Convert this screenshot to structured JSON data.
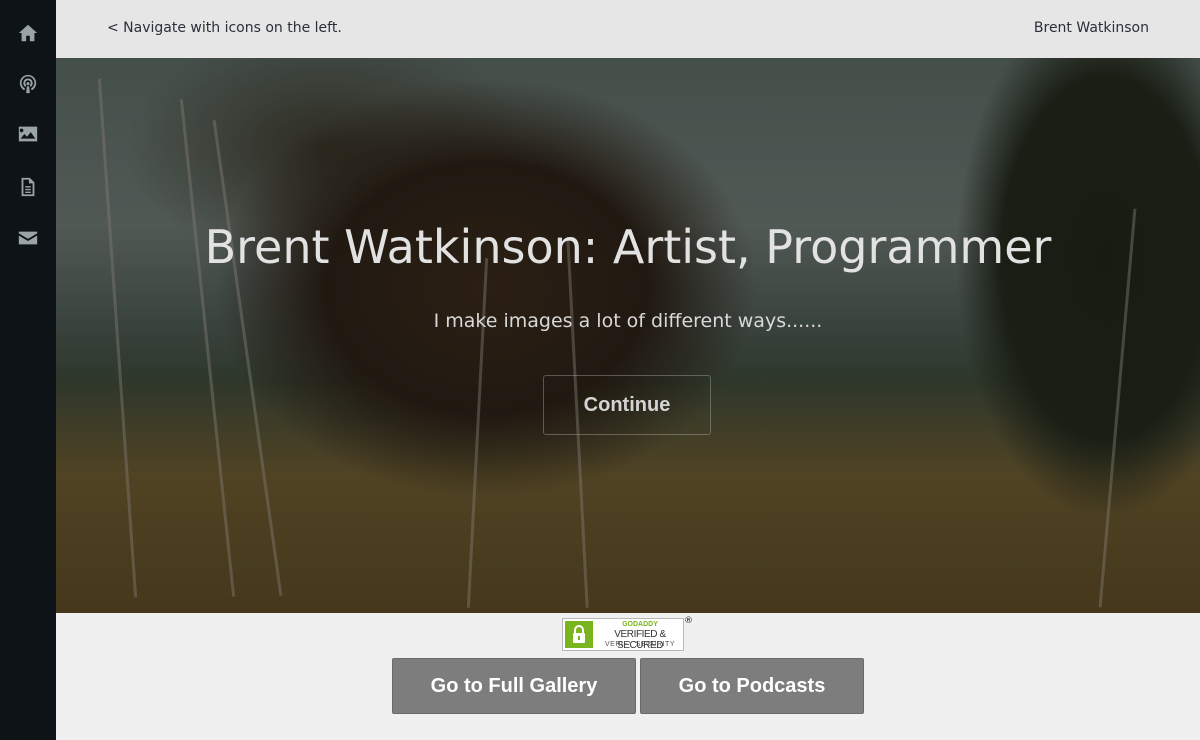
{
  "sidebar": {
    "icons": [
      "home-icon",
      "podcast-icon",
      "image-icon",
      "document-icon",
      "envelope-icon"
    ]
  },
  "header": {
    "nav_hint": "< Navigate with icons on the left.",
    "brand": "Brent Watkinson"
  },
  "hero": {
    "title": "Brent Watkinson: Artist, Programmer",
    "subtitle": "I make images a lot of different ways......",
    "continue_label": "Continue"
  },
  "seal": {
    "line1": "GODADDY",
    "line2": "VERIFIED & SECURED",
    "line3": "VERIFY SECURITY",
    "registered": "®"
  },
  "actions": {
    "gallery_label": "Go to Full Gallery",
    "podcasts_label": "Go to Podcasts"
  },
  "colors": {
    "sidebar_bg": "#0d1317",
    "topbar_bg": "#e6e6e6",
    "button_bg": "#7d7d7d",
    "seal_green": "#7ab51d"
  }
}
